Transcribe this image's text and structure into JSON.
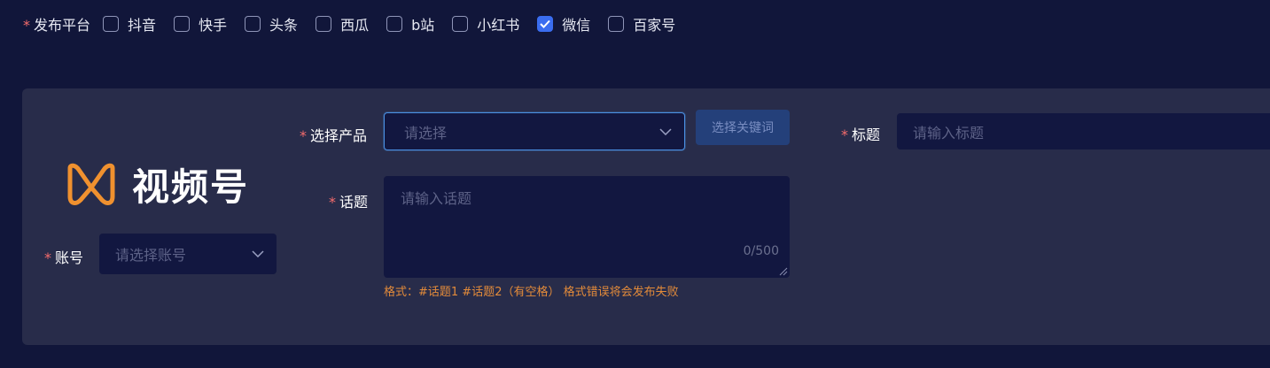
{
  "platforms": {
    "label": "发布平台",
    "items": [
      {
        "label": "抖音",
        "checked": false
      },
      {
        "label": "快手",
        "checked": false
      },
      {
        "label": "头条",
        "checked": false
      },
      {
        "label": "西瓜",
        "checked": false
      },
      {
        "label": "b站",
        "checked": false
      },
      {
        "label": "小红书",
        "checked": false
      },
      {
        "label": "微信",
        "checked": true
      },
      {
        "label": "百家号",
        "checked": false
      }
    ]
  },
  "card": {
    "logo_text": "视频号",
    "account": {
      "label": "账号",
      "placeholder": "请选择账号"
    },
    "product": {
      "label": "选择产品",
      "placeholder": "请选择"
    },
    "keyword_button": "选择关键词",
    "title": {
      "label": "标题",
      "placeholder": "请输入标题"
    },
    "topic": {
      "label": "话题",
      "placeholder": "请输入话题",
      "count": "0/500",
      "hint": "格式：#话题1 #话题2（有空格） 格式错误将会发布失败"
    }
  },
  "colors": {
    "background": "#11163a",
    "card": "#282c4a",
    "accent": "#3a6df0",
    "required": "#f56c6c",
    "hint": "#e38b3a",
    "logo_orange": "#f0912f"
  }
}
